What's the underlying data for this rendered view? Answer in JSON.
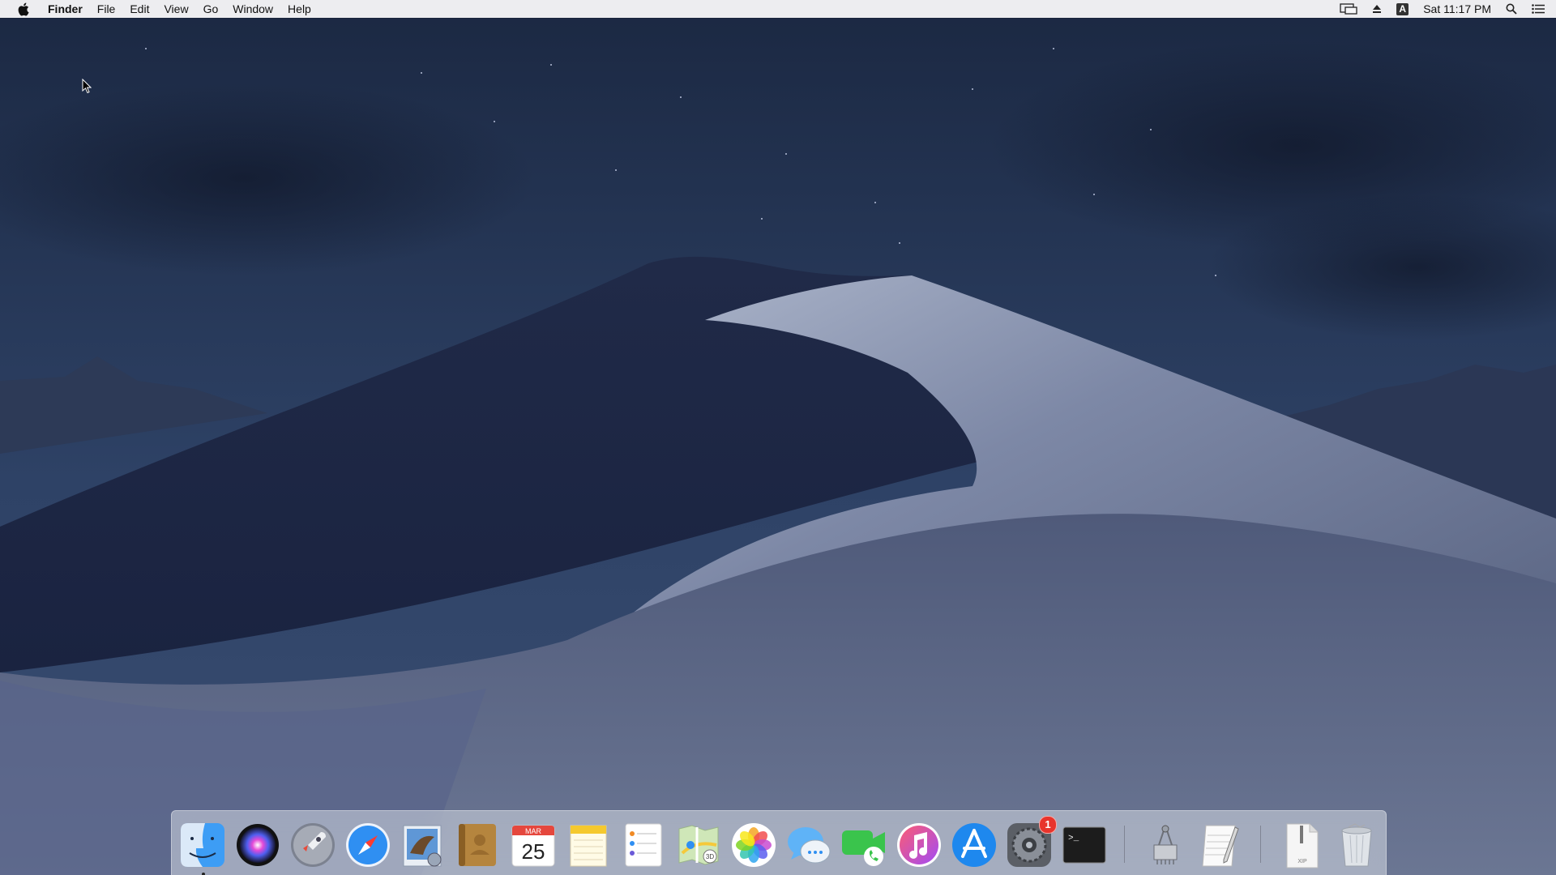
{
  "menubar": {
    "app_name": "Finder",
    "menus": [
      "File",
      "Edit",
      "View",
      "Go",
      "Window",
      "Help"
    ],
    "clock": "Sat 11:17 PM",
    "status_icons": [
      "screen-mirroring-icon",
      "eject-icon",
      "input-source-icon",
      "spotlight-search-icon",
      "notification-center-icon"
    ],
    "input_source_letter": "A"
  },
  "desktop": {
    "wallpaper": "macOS Mojave (Dark) dune"
  },
  "dock": {
    "apps": [
      {
        "name": "Finder",
        "icon": "finder-icon",
        "running": true
      },
      {
        "name": "Siri",
        "icon": "siri-icon"
      },
      {
        "name": "Launchpad",
        "icon": "launchpad-icon"
      },
      {
        "name": "Safari",
        "icon": "safari-icon"
      },
      {
        "name": "Mail",
        "icon": "mail-icon"
      },
      {
        "name": "Contacts",
        "icon": "contacts-icon"
      },
      {
        "name": "Calendar",
        "icon": "calendar-icon",
        "month": "MAR",
        "day": "25"
      },
      {
        "name": "Notes",
        "icon": "notes-icon"
      },
      {
        "name": "Reminders",
        "icon": "reminders-icon"
      },
      {
        "name": "Maps",
        "icon": "maps-icon",
        "label": "3D"
      },
      {
        "name": "Photos",
        "icon": "photos-icon"
      },
      {
        "name": "Messages",
        "icon": "messages-icon"
      },
      {
        "name": "FaceTime",
        "icon": "facetime-icon"
      },
      {
        "name": "iTunes",
        "icon": "itunes-icon"
      },
      {
        "name": "App Store",
        "icon": "app-store-icon"
      },
      {
        "name": "System Preferences",
        "icon": "system-preferences-icon",
        "badge": "1"
      },
      {
        "name": "Terminal",
        "icon": "terminal-icon",
        "prompt": ">_"
      }
    ],
    "extras": [
      {
        "name": "System Information",
        "icon": "system-information-icon"
      },
      {
        "name": "TextEdit",
        "icon": "textedit-icon"
      }
    ],
    "stacks": [
      {
        "name": "XIP Archive",
        "icon": "xip-archive-icon",
        "label": "XIP"
      },
      {
        "name": "Trash",
        "icon": "trash-icon"
      }
    ]
  },
  "colors": {
    "menubar_bg": "#f6f6f8",
    "sky_top": "#1c2a44",
    "sky_bottom": "#33466a",
    "badge": "#e8342c"
  }
}
